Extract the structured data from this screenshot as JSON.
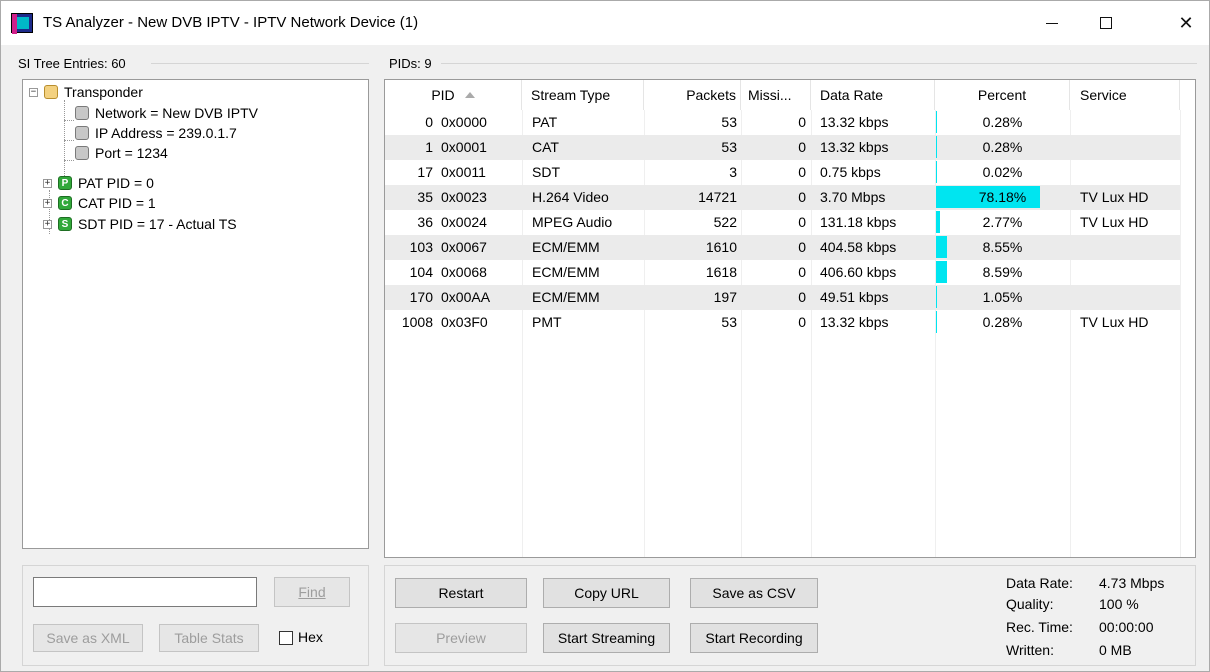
{
  "window": {
    "title": "TS Analyzer - New DVB IPTV - IPTV Network Device (1)"
  },
  "tree": {
    "header": "SI Tree Entries: 60",
    "nodes": [
      {
        "label": "Transponder",
        "icon": "folder-icon",
        "badge": ""
      },
      {
        "label": "Network = New DVB IPTV",
        "icon": "grey-node-icon",
        "badge": ""
      },
      {
        "label": "IP Address = 239.0.1.7",
        "icon": "grey-node-icon",
        "badge": ""
      },
      {
        "label": "Port = 1234",
        "icon": "grey-node-icon",
        "badge": ""
      },
      {
        "label": "PAT PID = 0",
        "icon": "pat-icon",
        "badge": "P"
      },
      {
        "label": "CAT PID = 1",
        "icon": "cat-icon",
        "badge": "C"
      },
      {
        "label": "SDT PID = 17 - Actual TS",
        "icon": "sdt-icon",
        "badge": "S"
      }
    ]
  },
  "pids": {
    "header": "PIDs: 9",
    "columns": [
      "PID",
      "Stream Type",
      "Packets",
      "Missi...",
      "Data Rate",
      "Percent",
      "Service"
    ],
    "rows": [
      {
        "pid": "0",
        "hex": "0x0000",
        "type": "PAT",
        "packets": "53",
        "missing": "0",
        "rate": "13.32 kbps",
        "percent": "0.28%",
        "pct": 0.28,
        "service": ""
      },
      {
        "pid": "1",
        "hex": "0x0001",
        "type": "CAT",
        "packets": "53",
        "missing": "0",
        "rate": "13.32 kbps",
        "percent": "0.28%",
        "pct": 0.28,
        "service": ""
      },
      {
        "pid": "17",
        "hex": "0x0011",
        "type": "SDT",
        "packets": "3",
        "missing": "0",
        "rate": "0.75 kbps",
        "percent": "0.02%",
        "pct": 0.02,
        "service": ""
      },
      {
        "pid": "35",
        "hex": "0x0023",
        "type": "H.264 Video",
        "packets": "14721",
        "missing": "0",
        "rate": "3.70 Mbps",
        "percent": "78.18%",
        "pct": 78.18,
        "service": "TV Lux HD"
      },
      {
        "pid": "36",
        "hex": "0x0024",
        "type": "MPEG Audio",
        "packets": "522",
        "missing": "0",
        "rate": "131.18 kbps",
        "percent": "2.77%",
        "pct": 2.77,
        "service": "TV Lux HD"
      },
      {
        "pid": "103",
        "hex": "0x0067",
        "type": "ECM/EMM",
        "packets": "1610",
        "missing": "0",
        "rate": "404.58 kbps",
        "percent": "8.55%",
        "pct": 8.55,
        "service": ""
      },
      {
        "pid": "104",
        "hex": "0x0068",
        "type": "ECM/EMM",
        "packets": "1618",
        "missing": "0",
        "rate": "406.60 kbps",
        "percent": "8.59%",
        "pct": 8.59,
        "service": ""
      },
      {
        "pid": "170",
        "hex": "0x00AA",
        "type": "ECM/EMM",
        "packets": "197",
        "missing": "0",
        "rate": "49.51 kbps",
        "percent": "1.05%",
        "pct": 1.05,
        "service": ""
      },
      {
        "pid": "1008",
        "hex": "0x03F0",
        "type": "PMT",
        "packets": "53",
        "missing": "0",
        "rate": "13.32 kbps",
        "percent": "0.28%",
        "pct": 0.28,
        "service": "TV Lux HD"
      }
    ],
    "bar_color": "#00e5f0"
  },
  "left_controls": {
    "search_value": "",
    "find": "Find",
    "save_xml": "Save as XML",
    "table_stats": "Table Stats",
    "hex": "Hex",
    "hex_checked": false
  },
  "right_controls": {
    "restart": "Restart",
    "copy_url": "Copy URL",
    "save_csv": "Save as CSV",
    "preview": "Preview",
    "start_streaming": "Start Streaming",
    "start_recording": "Start Recording"
  },
  "stats": {
    "data_rate_label": "Data Rate:",
    "data_rate": "4.73 Mbps",
    "quality_label": "Quality:",
    "quality": "100 %",
    "rec_time_label": "Rec. Time:",
    "rec_time": "00:00:00",
    "written_label": "Written:",
    "written": "0 MB"
  }
}
